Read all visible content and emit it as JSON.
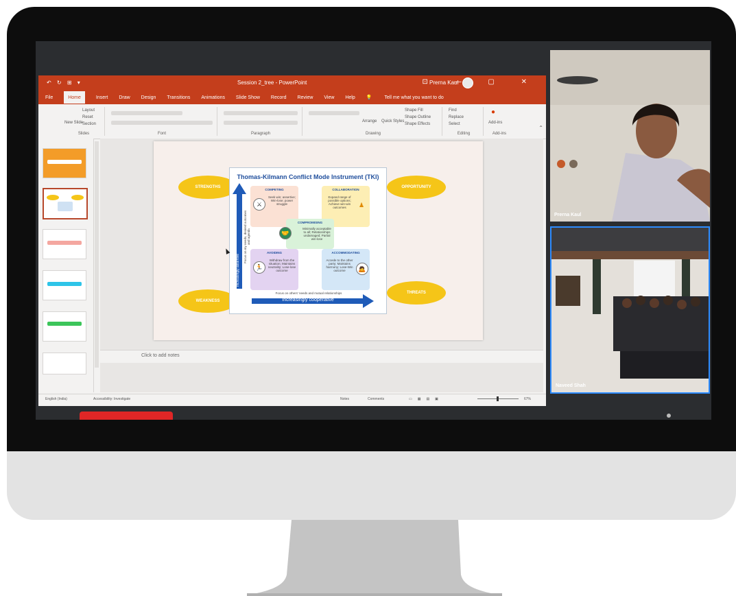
{
  "powerpoint": {
    "title_bar": {
      "quick_access": "↶ ↻ ⊞ ▾",
      "document_title": "Session 2_tree - PowerPoint",
      "user_name": "Prerna Kaul",
      "window_controls": "⊡ — ▢ ✕"
    },
    "tabs": [
      "File",
      "Home",
      "Insert",
      "Draw",
      "Design",
      "Transitions",
      "Animations",
      "Slide Show",
      "Record",
      "Review",
      "View",
      "Help"
    ],
    "active_tab": "Home",
    "tell_me": "Tell me what you want to do",
    "ribbon": {
      "groups": [
        "Slides",
        "Font",
        "Paragraph",
        "Drawing",
        "Editing",
        "Add-ins"
      ],
      "slides_buttons": [
        "Layout",
        "Reset",
        "New Slide",
        "Section"
      ],
      "drawing_buttons": [
        "Arrange",
        "Quick Styles",
        "Shape Fill",
        "Shape Outline",
        "Shape Effects"
      ],
      "editing_buttons": [
        "Find",
        "Replace",
        "Select"
      ],
      "addins_button": "Add-ins"
    },
    "notes_placeholder": "Click to add notes",
    "status_bar": {
      "language": "English (India)",
      "accessibility": "Accessibility: Investigate",
      "notes": "Notes",
      "comments": "Comments",
      "zoom": "67%"
    }
  },
  "slide": {
    "title": "Thomas-Kilmann Conflict Mode Instrument (TKI)",
    "ovals": [
      "STRENGTHS",
      "OPPORTUNITY",
      "WEAKNESS",
      "THREATS"
    ],
    "quadrants": {
      "competing": {
        "title": "COMPETING",
        "text": "Seek win; assertive; Win-lose; power struggle"
      },
      "collaboration": {
        "title": "COLLABORATION",
        "text": "Expand range of possible options; Achieve win-win outcomes"
      },
      "compromising": {
        "title": "COMPROMISING",
        "text": "Minimally acceptable to all; Relationships undamaged; Partial win-lose"
      },
      "avoiding": {
        "title": "AVOIDING",
        "text": "Withdraw from the situation; Maintains neutrality; Lose-lose outcome"
      },
      "accommodating": {
        "title": "ACCOMMODATING",
        "text": "Accede to the other party; Maintains harmony; Lose-Win outcome"
      }
    },
    "vertical_axis_label": "Increasingly assertive",
    "vertical_axis_note": "Focus on my needs, desired outcomes and agenda",
    "horizontal_axis_label": "Increasingly cooperative",
    "horizontal_axis_note": "Focus on others' needs and mutual relationships"
  },
  "video": {
    "participants": [
      "Prerna Kaul",
      "Naveed Shah"
    ]
  },
  "colors": {
    "ppt_red": "#c43e1c",
    "oval_yellow": "#f5c518",
    "arrow_blue": "#1f5bb8",
    "zoom_blue": "#2d8cff",
    "leave_red": "#e02626"
  }
}
